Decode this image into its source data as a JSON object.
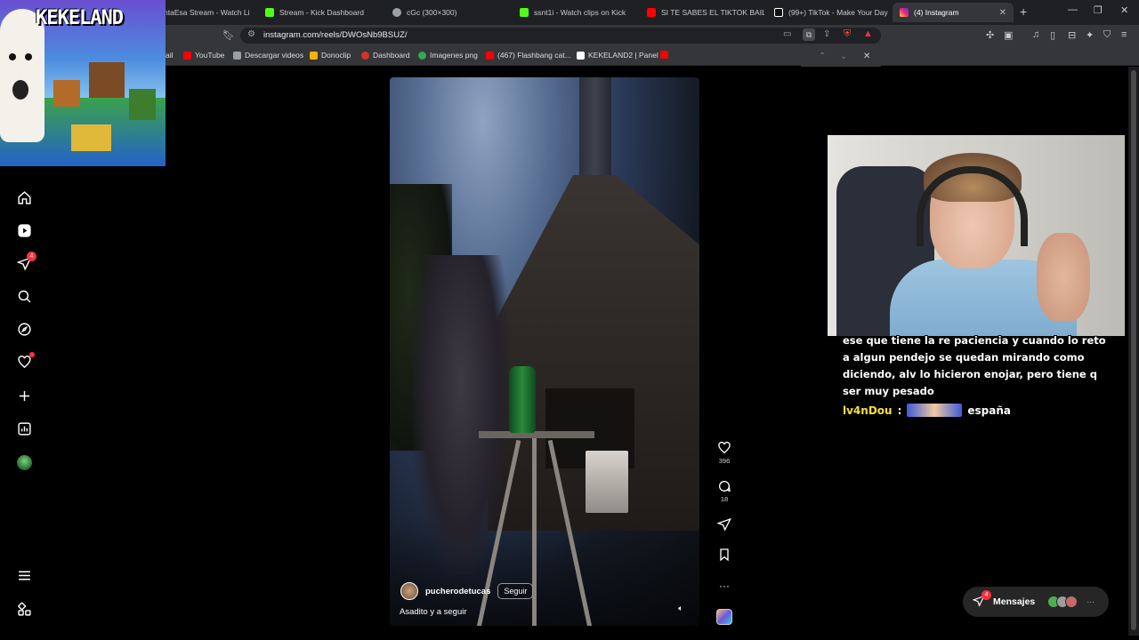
{
  "browser": {
    "tabs": [
      {
        "title": "ntaEsa Stream - Watch Li",
        "color": "#53fc18"
      },
      {
        "title": "Stream - Kick Dashboard",
        "color": "#53fc18"
      },
      {
        "title": "cGc (300×300)",
        "color": "#9aa0a6"
      },
      {
        "title": "ssnt1i - Watch clips on Kick",
        "color": "#53fc18"
      },
      {
        "title": "SI TE SABES EL TIKTOK BAILA!",
        "color": "#ff0000"
      },
      {
        "title": "(99+) TikTok - Make Your Day",
        "color": "#ffffff"
      },
      {
        "title": "(4) Instagram",
        "color": "#e1306c"
      }
    ],
    "url": "instagram.com/reels/DWOsNb9BSUZ/",
    "bookmarks": [
      {
        "label": "ail",
        "color": "#ea4335"
      },
      {
        "label": "YouTube",
        "color": "#ff0000"
      },
      {
        "label": "Descargar videos",
        "color": "#9aa0a6"
      },
      {
        "label": "Donoclip",
        "color": "#f4b400"
      },
      {
        "label": "Dashboard",
        "color": "#d93025"
      },
      {
        "label": "Imagenes png",
        "color": "#34a853"
      },
      {
        "label": "(467) Flashbang cat...",
        "color": "#ff0000"
      },
      {
        "label": "KEKELAND2 | Panel",
        "color": "#ffffff"
      },
      {
        "label": "",
        "color": "#ff0000"
      }
    ]
  },
  "overlay": {
    "title": "KEKELAND"
  },
  "sidebar": {
    "notifications_badge": "4"
  },
  "reel": {
    "username": "pucherodetucas",
    "follow_label": "Seguir",
    "caption": "Asadito y a seguir",
    "likes": "396",
    "comments": "18"
  },
  "chat": {
    "message_text": "ese que tiene la re paciencia y cuando lo reto a algun pendejo se quedan mirando como diciendo, alv lo hicieron enojar, pero tiene q ser muy pesado",
    "username": "lv4nDou",
    "separator": ":",
    "message": "españa"
  },
  "messages": {
    "label": "Mensajes",
    "badge": "4",
    "more": "···"
  }
}
